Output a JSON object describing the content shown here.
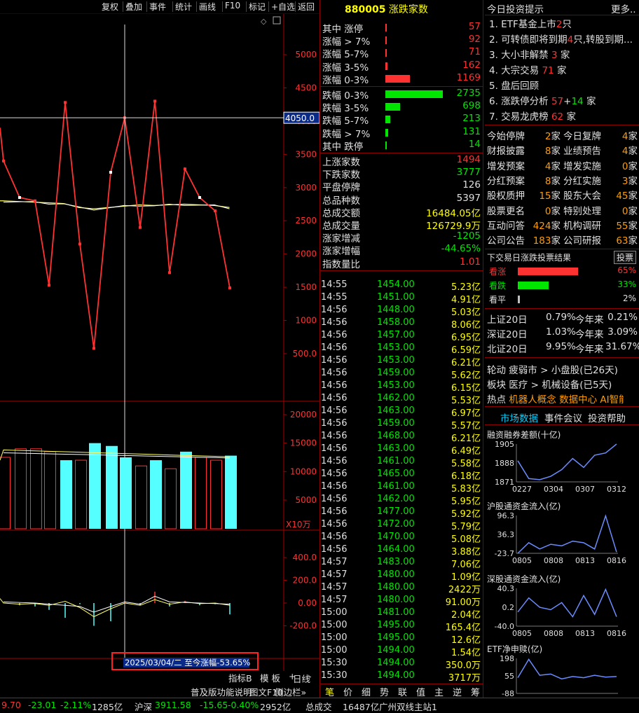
{
  "toolbar": {
    "items": [
      "复权",
      "叠加",
      "事件",
      "统计",
      "画线",
      "F10",
      "标记",
      "+自选",
      "返回"
    ]
  },
  "chart": {
    "price_axis": [
      "5000",
      "4500",
      "4000",
      "3500",
      "3000",
      "2500",
      "2000",
      "1500",
      "1000",
      "500.0"
    ],
    "crosshair_value": "4050.0",
    "volume_axis": [
      "20000",
      "15000",
      "10000",
      "5000"
    ],
    "volume_unit": "X10万",
    "ind_axis": [
      "400.0",
      "200.0",
      "0.00",
      "-200.0"
    ],
    "date_label": "2025/03/04/二  至今涨幅-53.65%",
    "period": "日线",
    "tabs": [
      "指标B",
      "模 板",
      "+",
      "-"
    ],
    "bottom_items": [
      "普及版功能说明",
      "图文F10",
      "侧边栏»"
    ]
  },
  "mid": {
    "code": "880005",
    "name": "涨跌家数",
    "dist": [
      {
        "label": "其中 涨停",
        "value": "57",
        "color": "#ff3232",
        "frac": 0.01
      },
      {
        "label": "涨幅 > 7%",
        "value": "92",
        "color": "#ff3232",
        "frac": 0.03
      },
      {
        "label": "涨幅 5-7%",
        "value": "71",
        "color": "#ff3232",
        "frac": 0.03
      },
      {
        "label": "涨幅 3-5%",
        "value": "162",
        "color": "#ff3232",
        "frac": 0.04
      },
      {
        "label": "涨幅 0-3%",
        "value": "1169",
        "color": "#ff3232",
        "frac": 0.43
      },
      {
        "label": "跌幅 0-3%",
        "value": "2735",
        "color": "#00e600",
        "frac": 1.0
      },
      {
        "label": "跌幅 3-5%",
        "value": "698",
        "color": "#00e600",
        "frac": 0.26
      },
      {
        "label": "跌幅 5-7%",
        "value": "213",
        "color": "#00e600",
        "frac": 0.08
      },
      {
        "label": "跌幅 > 7%",
        "value": "131",
        "color": "#00e600",
        "frac": 0.05
      },
      {
        "label": "其中 跌停",
        "value": "14",
        "color": "#00e600",
        "frac": 0.01
      }
    ],
    "stats": [
      {
        "label": "上涨家数",
        "value": "1494",
        "color": "#ff3232"
      },
      {
        "label": "下跌家数",
        "value": "3777",
        "color": "#00e600"
      },
      {
        "label": "平盘停牌",
        "value": "126",
        "color": "#e0e0e0"
      },
      {
        "label": "总品种数",
        "value": "5397",
        "color": "#e0e0e0"
      },
      {
        "label": "总成交额",
        "value": "16484.05亿",
        "color": "#ffff00"
      },
      {
        "label": "总成交量",
        "value": "126729.9万",
        "color": "#ffff00"
      },
      {
        "label": "涨家增减",
        "value": "-1205",
        "color": "#00e600"
      },
      {
        "label": "涨家增幅",
        "value": "-44.65%",
        "color": "#00e600"
      },
      {
        "label": "指数量比",
        "value": "1.01",
        "color": "#ff3232"
      }
    ],
    "ticks": [
      [
        "14:55",
        "1454.00",
        "5.23亿"
      ],
      [
        "14:55",
        "1451.00",
        "4.91亿"
      ],
      [
        "14:56",
        "1448.00",
        "5.03亿"
      ],
      [
        "14:56",
        "1458.00",
        "8.06亿"
      ],
      [
        "14:56",
        "1457.00",
        "6.95亿"
      ],
      [
        "14:56",
        "1453.00",
        "6.59亿"
      ],
      [
        "14:56",
        "1453.00",
        "6.21亿"
      ],
      [
        "14:56",
        "1459.00",
        "5.62亿"
      ],
      [
        "14:56",
        "1453.00",
        "6.15亿"
      ],
      [
        "14:56",
        "1462.00",
        "5.53亿"
      ],
      [
        "14:56",
        "1463.00",
        "6.97亿"
      ],
      [
        "14:56",
        "1459.00",
        "5.57亿"
      ],
      [
        "14:56",
        "1468.00",
        "6.21亿"
      ],
      [
        "14:56",
        "1463.00",
        "6.49亿"
      ],
      [
        "14:56",
        "1461.00",
        "5.58亿"
      ],
      [
        "14:56",
        "1465.00",
        "6.18亿"
      ],
      [
        "14:56",
        "1461.00",
        "5.83亿"
      ],
      [
        "14:56",
        "1462.00",
        "5.95亿"
      ],
      [
        "14:56",
        "1477.00",
        "5.92亿"
      ],
      [
        "14:56",
        "1472.00",
        "5.79亿"
      ],
      [
        "14:56",
        "1470.00",
        "5.08亿"
      ],
      [
        "14:56",
        "1464.00",
        "3.88亿"
      ],
      [
        "14:57",
        "1483.00",
        "7.06亿"
      ],
      [
        "14:57",
        "1480.00",
        "1.09亿"
      ],
      [
        "14:57",
        "1480.00",
        "2422万"
      ],
      [
        "14:57",
        "1480.00",
        "91.00万"
      ],
      [
        "15:00",
        "1481.00",
        "2.04亿"
      ],
      [
        "15:00",
        "1495.00",
        "165.4亿"
      ],
      [
        "15:00",
        "1495.00",
        "12.6亿"
      ],
      [
        "15:00",
        "1494.00",
        "1.54亿"
      ],
      [
        "15:30",
        "1494.00",
        "350.0万"
      ],
      [
        "15:30",
        "1494.00",
        "3717万"
      ]
    ],
    "tabs": [
      "笔",
      "价",
      "细",
      "势",
      "联",
      "值",
      "主",
      "逆",
      "筹"
    ]
  },
  "right": {
    "title": "今日投资提示",
    "more": "更多..",
    "tips": [
      {
        "n": "1.",
        "a": "ETF基金上市",
        "b": "2",
        "c": "只",
        "d": "",
        "e": ""
      },
      {
        "n": "2.",
        "a": "可转债即将到期",
        "b": "4",
        "c": "只,转股到期...",
        "d": "",
        "e": ""
      },
      {
        "n": "3.",
        "a": "大小非解禁 ",
        "b": "3",
        "c": " 家",
        "d": "",
        "e": ""
      },
      {
        "n": "4.",
        "a": "大宗交易 ",
        "b": "71",
        "c": " 家",
        "d": "",
        "e": ""
      },
      {
        "n": "5.",
        "a": "盘后回顾",
        "b": "",
        "c": "",
        "d": "",
        "e": ""
      },
      {
        "n": "6.",
        "a": "涨跌停分析 ",
        "b": "57",
        "c": "+",
        "d": "14",
        "e": " 家"
      },
      {
        "n": "7.",
        "a": "交易龙虎榜 ",
        "b": "62",
        "c": " 家",
        "d": "",
        "e": ""
      }
    ],
    "grid": [
      [
        "今始停牌",
        "2",
        "今日复牌",
        "4"
      ],
      [
        "财报披露",
        "8",
        "业绩预告",
        "4"
      ],
      [
        "增发预案",
        "4",
        "增发实施",
        "0"
      ],
      [
        "分红预案",
        "8",
        "分红实施",
        "3"
      ],
      [
        "股权质押",
        "15",
        "股东大会",
        "45"
      ],
      [
        "股票更名",
        "0",
        "特别处理",
        "0"
      ],
      [
        "互动问答",
        "424",
        "机构调研",
        "55"
      ],
      [
        "公司公告",
        "183",
        "公司研报",
        "63"
      ]
    ],
    "unit": "家",
    "vote": {
      "title": "下交易日涨跌投票结果",
      "button": "投票",
      "rows": [
        {
          "label": "看涨",
          "pct": "65%",
          "frac": 0.65,
          "color": "#ff3232"
        },
        {
          "label": "看跌",
          "pct": "33%",
          "frac": 0.33,
          "color": "#00e600"
        },
        {
          "label": "看平",
          "pct": "2%",
          "frac": 0.02,
          "color": "#c0c0c0"
        }
      ]
    },
    "indices": [
      {
        "name": "上证20日",
        "v1": "0.79%",
        "mid": "今年来",
        "v2": "0.21%"
      },
      {
        "name": "深证20日",
        "v1": "1.03%",
        "mid": "今年来",
        "v2": "3.09%"
      },
      {
        "name": "北证20日",
        "v1": "9.95%",
        "mid": "今年来",
        "v2": "31.67%"
      }
    ],
    "rotation": {
      "l1": "轮动",
      "l1a": "疲弱市",
      "l1b": "小盘股",
      "l1c": "(已26天)",
      "l2": "板块",
      "l2a": "医疗",
      "l2b": "机械设备",
      "l2c": "(已5天)",
      "l3": "热点",
      "l3a": "机器人概念",
      "l3b": "数据中心",
      "l3c": "AI智能体"
    },
    "tabs": [
      "市场数据",
      "事件会议",
      "投资帮助"
    ],
    "minis": [
      {
        "title": "融资融券差额(十亿)",
        "y": [
          "1905",
          "1888",
          "1871"
        ],
        "x": [
          "0227",
          "0304",
          "0307",
          "0312"
        ],
        "values": [
          1890,
          1874,
          1873,
          1876,
          1882,
          1892,
          1884,
          1895,
          1897,
          1906
        ]
      },
      {
        "title": "沪股通资金流入(亿)",
        "y": [
          "96.3",
          "36.3",
          "-23.7"
        ],
        "x": [
          "0805",
          "0808",
          "0813",
          "0816"
        ],
        "values": [
          -25,
          10,
          -10,
          5,
          0,
          15,
          10,
          -10,
          95,
          -20
        ]
      },
      {
        "title": "深股通资金流入(亿)",
        "y": [
          "40.3",
          "0.2",
          "-40.0"
        ],
        "x": [
          "0805",
          "0808",
          "0813",
          "0816"
        ],
        "values": [
          -10,
          20,
          0,
          -5,
          10,
          -20,
          25,
          -15,
          38,
          -20
        ]
      },
      {
        "title": "ETF净申赎(亿)",
        "y": [
          "198",
          "55",
          "-88"
        ],
        "x": [],
        "values": [
          40,
          190,
          60,
          70,
          30,
          50,
          40,
          60,
          45,
          50
        ]
      }
    ]
  },
  "status": [
    {
      "t": "9.70",
      "c": "#ff3232"
    },
    {
      "t": "-23.01",
      "c": "#00e600"
    },
    {
      "t": "-2.11%",
      "c": "#00e600"
    },
    {
      "t": "1285亿",
      "c": "#e0e0e0"
    },
    {
      "t": "沪深",
      "c": "#e0e0e0"
    },
    {
      "t": "3911.58",
      "c": "#00e600"
    },
    {
      "t": "-15.65",
      "c": "#00e600"
    },
    {
      "t": "-0.40%",
      "c": "#00e600"
    },
    {
      "t": "2952亿",
      "c": "#e0e0e0"
    },
    {
      "t": "总成交",
      "c": "#e0e0e0"
    },
    {
      "t": "16487亿",
      "c": "#e0e0e0"
    },
    {
      "t": "广州双线主站1",
      "c": "#e0e0e0"
    }
  ],
  "chart_data": {
    "type": "line",
    "price_series": [
      3400,
      2850,
      2800,
      1530,
      4280,
      2150,
      580,
      3230,
      4050,
      2400,
      4300,
      1720,
      3280,
      2850,
      2650,
      1490
    ],
    "ma_series": [
      2800,
      2790,
      2780,
      2770,
      2760,
      2700,
      2680,
      2700,
      2720,
      2740,
      2730,
      2740,
      2750,
      2740,
      2730,
      2700
    ],
    "volume": [
      12500,
      14000,
      14000,
      13500,
      12000,
      12000,
      15000,
      14500,
      12500,
      11000,
      12000,
      10500,
      13500,
      12500,
      12000,
      12800
    ],
    "volume_cyan": [
      false,
      false,
      false,
      false,
      true,
      false,
      true,
      true,
      true,
      false,
      true,
      false,
      true,
      false,
      false,
      true
    ]
  }
}
